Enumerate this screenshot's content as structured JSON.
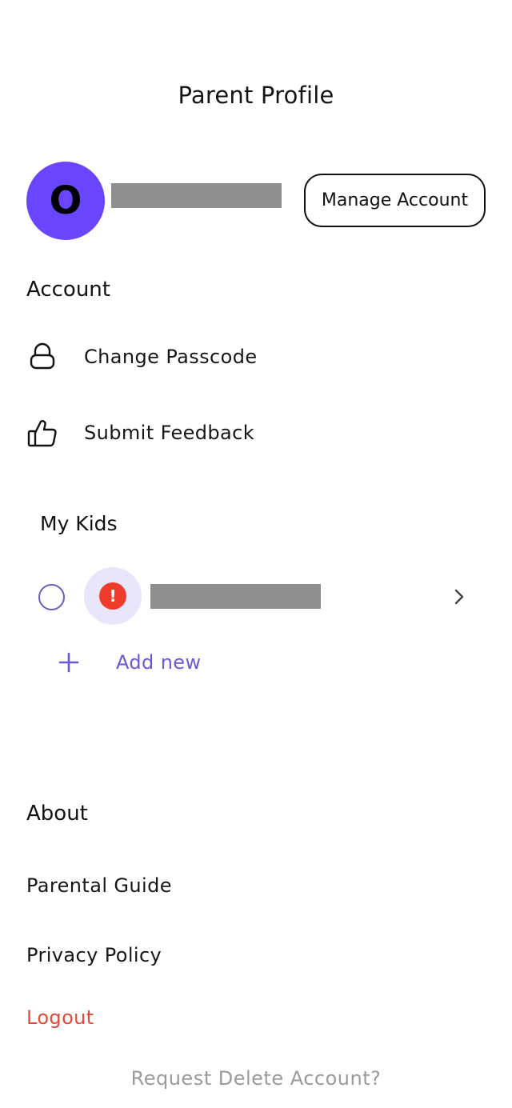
{
  "header": {
    "title": "Parent Profile"
  },
  "profile": {
    "avatar_initial": "O",
    "avatar_color": "#6a45ff",
    "manage_label": "Manage Account"
  },
  "account": {
    "heading": "Account",
    "items": [
      {
        "label": "Change Passcode",
        "icon": "lock-icon"
      },
      {
        "label": "Submit Feedback",
        "icon": "thumbs-up-icon"
      }
    ]
  },
  "kids": {
    "heading": "My Kids",
    "entries": [
      {
        "status_icon": "alert-icon",
        "alert_symbol": "!",
        "alert_color": "#ef3b2c",
        "avatar_bg": "#e9e6fb"
      }
    ],
    "add_label": "Add new",
    "accent_color": "#6a58d6"
  },
  "about": {
    "heading": "About",
    "links": [
      "Parental Guide",
      "Privacy Policy"
    ]
  },
  "logout_label": "Logout",
  "logout_color": "#e2493a",
  "delete_label": "Request Delete Account?"
}
